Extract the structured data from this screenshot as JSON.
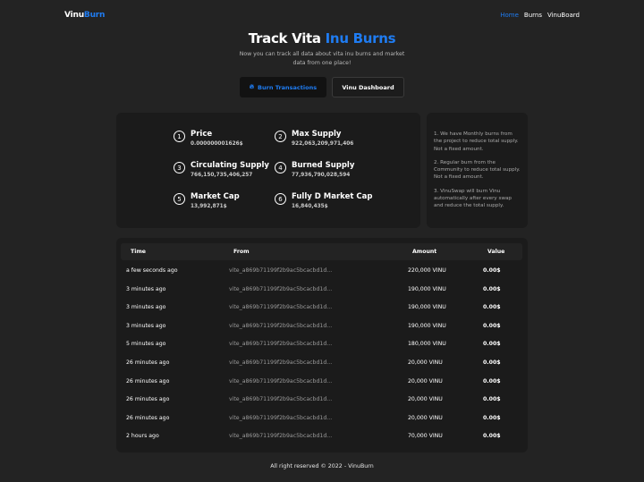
{
  "header": {
    "logo_main": "Vinu",
    "logo_accent": "Burn",
    "nav": [
      "Home",
      "Burns",
      "VinuBoard"
    ]
  },
  "hero": {
    "title_main": "Track Vita ",
    "title_accent": "Inu Burns",
    "subtitle": "Now you can track all data about vita inu burns and market data from one place!"
  },
  "buttons": {
    "burn_transactions": "Burn Transactions",
    "vinu_dashboard": "Vinu Dashboard"
  },
  "stats": [
    {
      "num": "1",
      "label": "Price",
      "value": "0.000000001626$"
    },
    {
      "num": "2",
      "label": "Max Supply",
      "value": "922,063,209,971,406"
    },
    {
      "num": "3",
      "label": "Circulating Supply",
      "value": "766,150,735,406,257"
    },
    {
      "num": "4",
      "label": "Burned Supply",
      "value": "77,936,790,028,594"
    },
    {
      "num": "5",
      "label": "Market Cap",
      "value": "13,992,871$"
    },
    {
      "num": "6",
      "label": "Fully D Market Cap",
      "value": "16,840,435$"
    }
  ],
  "info": [
    "1. We have Monthly burns from the project to reduce total supply. Not a fixed amount.",
    "2. Regular burn from the Community to reduce total supply. Not a fixed amount.",
    "3. VinuSwap will burn Vinu automatically after every swap and reduce the total supply."
  ],
  "table": {
    "headers": {
      "time": "Time",
      "from": "From",
      "amount": "Amount",
      "value": "Value"
    },
    "rows": [
      {
        "time": "a few seconds ago",
        "from": "vite_a869b71199f2b9ac5bcacbd1d...",
        "amount": "220,000 VINU",
        "value": "0.00$"
      },
      {
        "time": "3 minutes ago",
        "from": "vite_a869b71199f2b9ac5bcacbd1d...",
        "amount": "190,000 VINU",
        "value": "0.00$"
      },
      {
        "time": "3 minutes ago",
        "from": "vite_a869b71199f2b9ac5bcacbd1d...",
        "amount": "190,000 VINU",
        "value": "0.00$"
      },
      {
        "time": "3 minutes ago",
        "from": "vite_a869b71199f2b9ac5bcacbd1d...",
        "amount": "190,000 VINU",
        "value": "0.00$"
      },
      {
        "time": "5 minutes ago",
        "from": "vite_a869b71199f2b9ac5bcacbd1d...",
        "amount": "180,000 VINU",
        "value": "0.00$"
      },
      {
        "time": "26 minutes ago",
        "from": "vite_a869b71199f2b9ac5bcacbd1d...",
        "amount": "20,000 VINU",
        "value": "0.00$"
      },
      {
        "time": "26 minutes ago",
        "from": "vite_a869b71199f2b9ac5bcacbd1d...",
        "amount": "20,000 VINU",
        "value": "0.00$"
      },
      {
        "time": "26 minutes ago",
        "from": "vite_a869b71199f2b9ac5bcacbd1d...",
        "amount": "20,000 VINU",
        "value": "0.00$"
      },
      {
        "time": "26 minutes ago",
        "from": "vite_a869b71199f2b9ac5bcacbd1d...",
        "amount": "20,000 VINU",
        "value": "0.00$"
      },
      {
        "time": "2 hours ago",
        "from": "vite_a869b71199f2b9ac5bcacbd1d...",
        "amount": "70,000 VINU",
        "value": "0.00$"
      }
    ]
  },
  "footer": "All right reserved © 2022 - VinuBurn",
  "colors": {
    "accent": "#1f7cf2",
    "background": "#232323",
    "card": "#1b1b1b"
  },
  "icons": {
    "burn_button": "fire-icon"
  }
}
